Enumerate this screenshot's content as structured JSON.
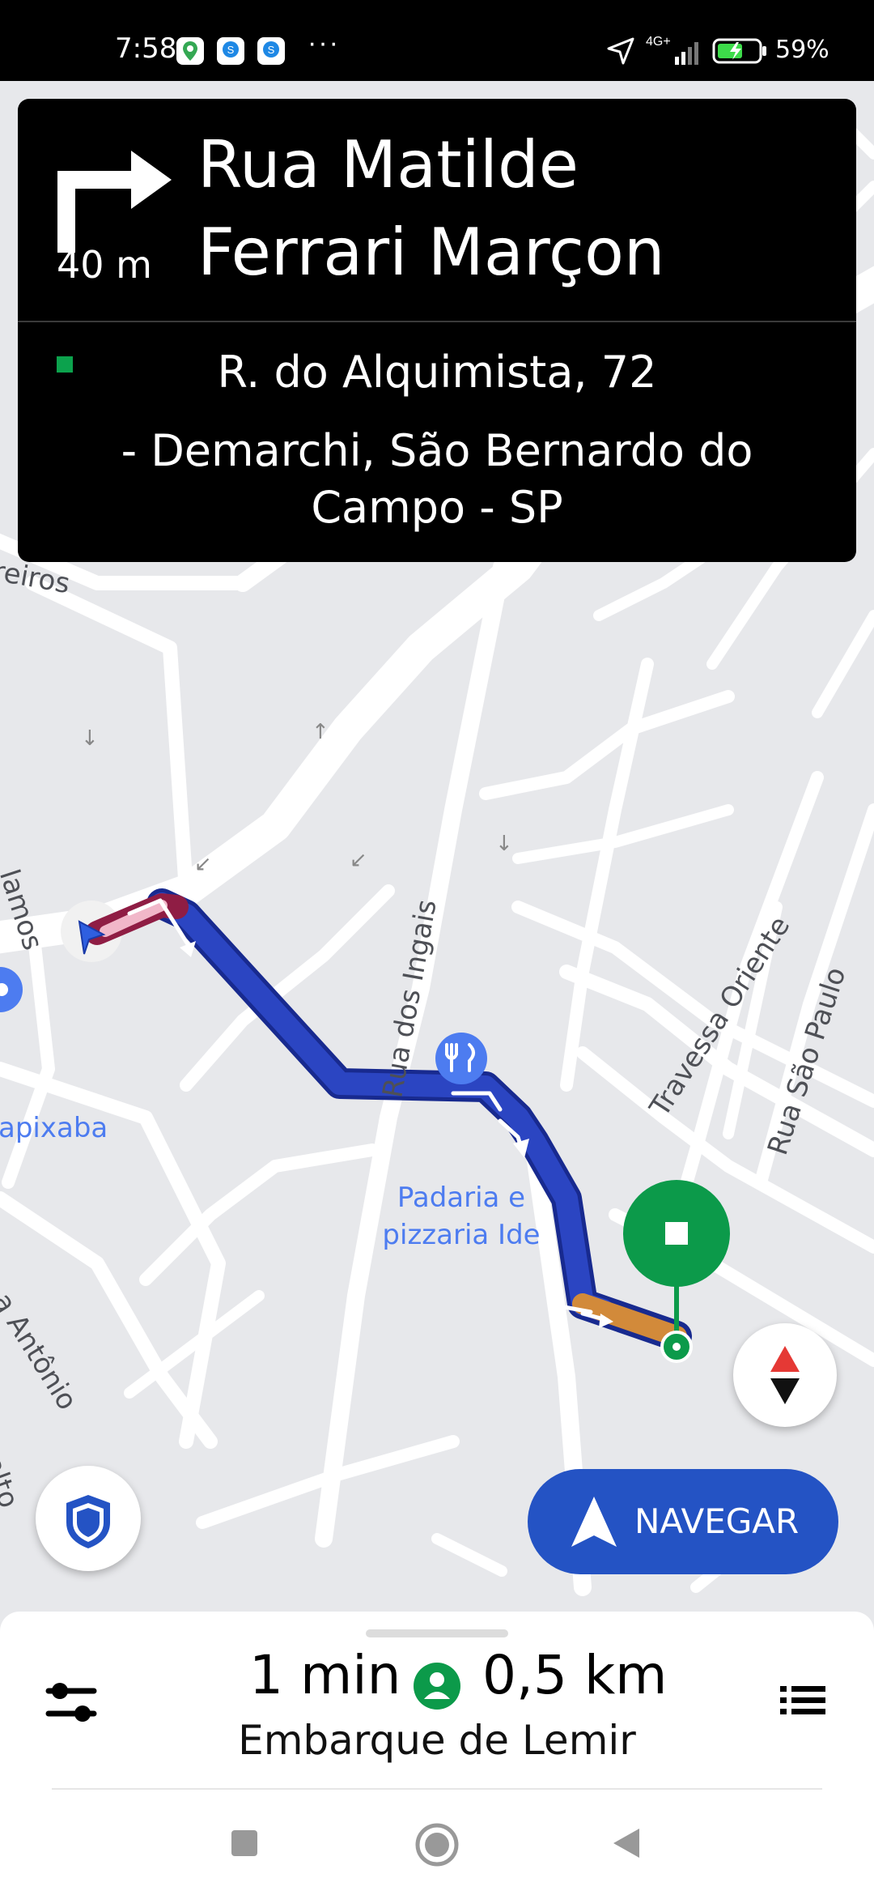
{
  "status_bar": {
    "time": "7:58",
    "network": "4G+",
    "battery": "59%",
    "more": "···"
  },
  "instruction": {
    "maneuver_icon": "turn-right-icon",
    "distance": "40 m",
    "street_line1": "Rua Matilde",
    "street_line2": "Ferrari Marçon",
    "destination_line1": "R. do Alquimista, 72",
    "destination_line2": "- Demarchi, São Bernardo do",
    "destination_line3": "Campo - SP"
  },
  "map": {
    "labels": [
      "reiros",
      "lamos",
      "Rua dos Ingais",
      "Travessa Oriente",
      "Rua São Paulo",
      "a Antônio",
      "alto"
    ],
    "pois": {
      "left_label": "apixaba",
      "bakery_line1": "Padaria e",
      "bakery_line2": "pizzaria Ide"
    }
  },
  "buttons": {
    "navegar": "NAVEGAR"
  },
  "trip": {
    "eta": "1 min",
    "distance": "0,5 km",
    "subtitle": "Embarque de Lemir"
  },
  "colors": {
    "route": "#2a3fb8",
    "route_start": "#a8224a",
    "route_end": "#d28a3a",
    "destination": "#0c9a4a",
    "navegar": "#2453c4"
  }
}
